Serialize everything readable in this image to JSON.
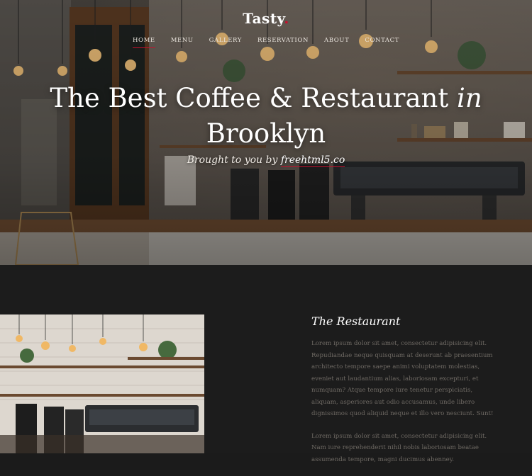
{
  "brand": {
    "name": "Tasty",
    "dot": "."
  },
  "nav": {
    "items": [
      {
        "label": "HOME",
        "active": true
      },
      {
        "label": "MENU"
      },
      {
        "label": "GALLERY"
      },
      {
        "label": "RESERVATION"
      },
      {
        "label": "ABOUT"
      },
      {
        "label": "CONTACT"
      }
    ]
  },
  "hero": {
    "headline_main": "The Best Coffee & Restaurant ",
    "headline_em": "in",
    "headline_line2": "Brooklyn",
    "byline_prefix": "Brought to you by ",
    "byline_link": "freehtml5.co"
  },
  "restaurant": {
    "heading": "The Restaurant",
    "paragraphs": [
      "Lorem ipsum dolor sit amet, consectetur adipisicing elit. Repudiandae neque quisquam at deserunt ab praesentium architecto tempore saepe animi voluptatem molestias, eveniet aut laudantium alias, laboriosam excepturi, et numquam? Atque tempore iure tenetur perspiciatis, aliquam, asperiores aut odio accusamus, unde libero dignissimos quod aliquid neque et illo vero nesciunt. Sunt!",
      "Lorem ipsum dolor sit amet, consectetur adipisicing elit. Nam iure reprehenderit nihil nobis laboriosam beatae assumenda tempore, magni ducimus abenney."
    ]
  },
  "colors": {
    "accent": "#c8102e",
    "section_bg": "#1c1c1c",
    "body_text": "#6f6a64"
  }
}
